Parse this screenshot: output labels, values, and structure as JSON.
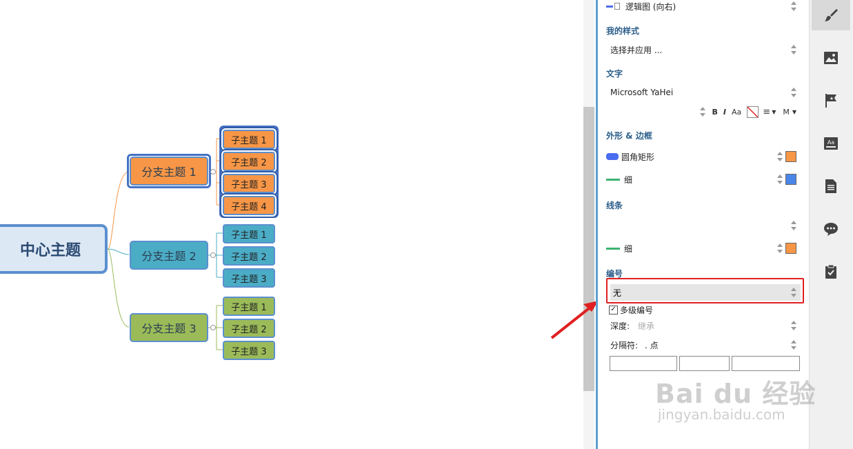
{
  "mindmap": {
    "central": "中心主题",
    "branches": [
      {
        "label": "分支主题 1",
        "color": "#f79646",
        "children": [
          "子主题 1",
          "子主题 2",
          "子主题 3",
          "子主题 4"
        ]
      },
      {
        "label": "分支主题 2",
        "color": "#4bacc6",
        "children": [
          "子主题 1",
          "子主题 2",
          "子主题 3"
        ]
      },
      {
        "label": "分支主题 3",
        "color": "#9bbb59",
        "children": [
          "子主题 1",
          "子主题 2",
          "子主题 3"
        ]
      }
    ]
  },
  "panel": {
    "structure": "逻辑图 (向右)",
    "my_style_title": "我的样式",
    "my_style_value": "选择并应用 ...",
    "text_title": "文字",
    "font_value": "Microsoft YaHei",
    "format": {
      "bold": "B",
      "italic": "I",
      "case": "Aa",
      "size": "M"
    },
    "shape_title": "外形 & 边框",
    "shape_value": "圆角矩形",
    "border_value": "细",
    "shape_color": "#f79646",
    "border_color": "#4a86e8",
    "line_title": "线条",
    "line_value": "细",
    "line_color": "#f79646",
    "numbering_title": "编号",
    "numbering_value": "无",
    "multi_level_label": "多级编号",
    "depth_label": "深度:",
    "depth_value": "继承",
    "separator_label": "分隔符:",
    "separator_value": ". 点"
  },
  "toolbar": {
    "tools": [
      "style-brush-icon",
      "image-icon",
      "marker-flag-icon",
      "text-format-icon",
      "notes-document-icon",
      "comment-icon",
      "task-clipboard-icon"
    ]
  },
  "watermark": {
    "main": "Bai du 经验",
    "sub": "jingyan.baidu.com"
  }
}
